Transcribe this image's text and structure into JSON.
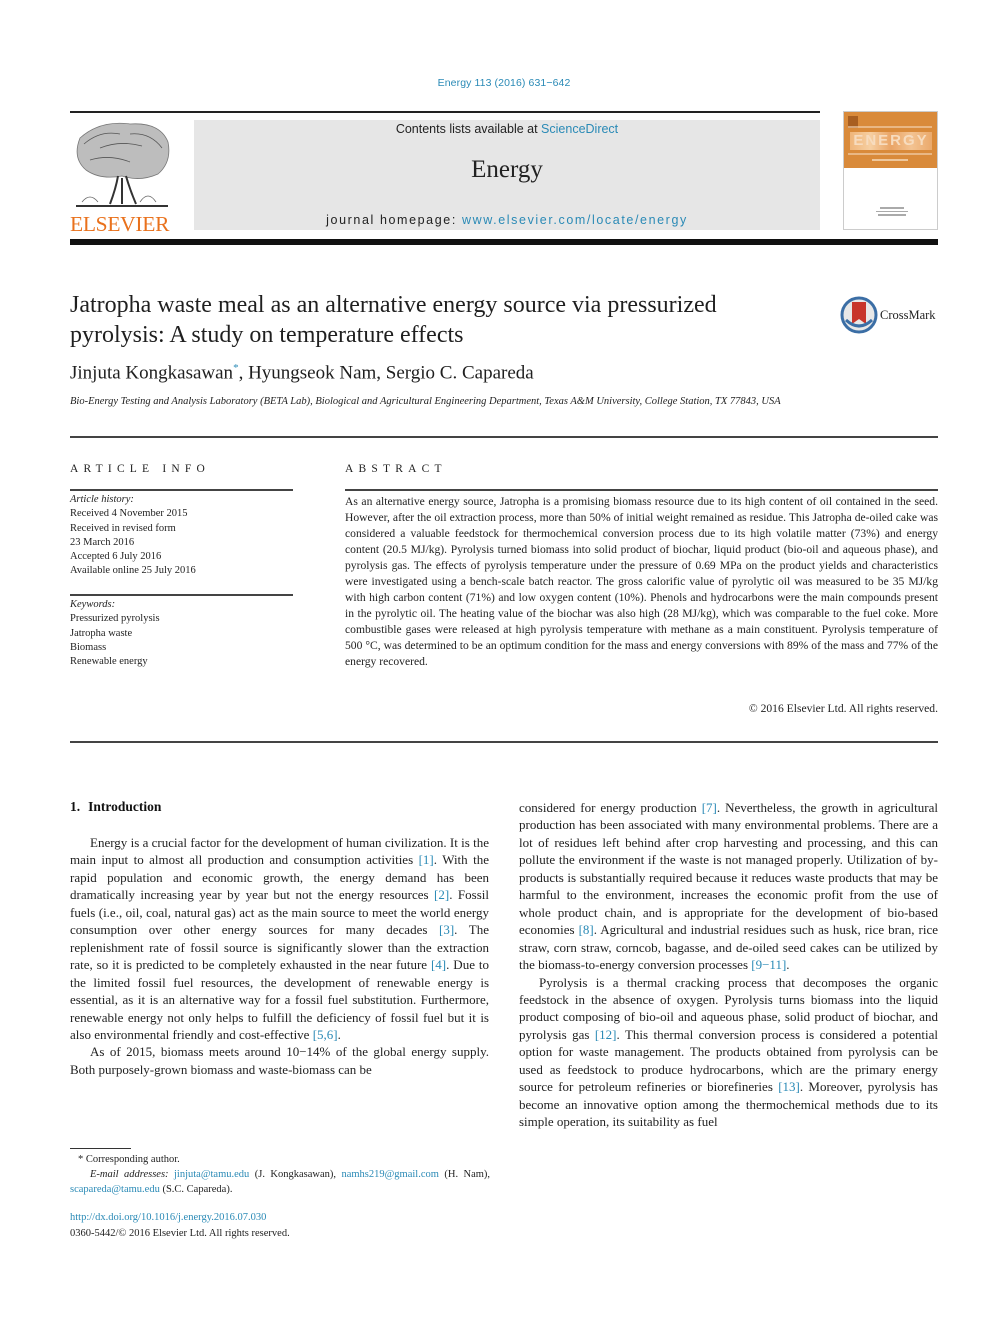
{
  "header": {
    "citation": "Energy 113 (2016) 631−642",
    "contents_prefix": "Contents lists available at ",
    "contents_link": "ScienceDirect",
    "journal_name": "Energy",
    "homepage_prefix": "journal homepage: ",
    "homepage_link": "www.elsevier.com/locate/energy",
    "publisher_logo": "ELSEVIER",
    "cover_word": "ENERGY",
    "crossmark_label": "CrossMark",
    "colors": {
      "link": "#2a8ab6",
      "elsevier_orange": "#e9711c",
      "cover_orange": "#d98a3a",
      "banner_gray": "#e6e6e6"
    }
  },
  "article": {
    "title_line1": "Jatropha waste meal as an alternative energy source via pressurized",
    "title_line2": "pyrolysis: A study on temperature effects",
    "authors": [
      {
        "name": "Jinjuta Kongkasawan",
        "mark": "*"
      },
      {
        "name": "Hyungseok Nam"
      },
      {
        "name": "Sergio C. Capareda"
      }
    ],
    "author_sep": ", ",
    "affiliation": "Bio-Energy Testing and Analysis Laboratory (BETA Lab), Biological and Agricultural Engineering Department, Texas A&M University, College Station, TX 77843, USA"
  },
  "article_info": {
    "heading": "ARTICLE INFO",
    "history_label": "Article history:",
    "history": [
      "Received 4 November 2015",
      "Received in revised form",
      "23 March 2016",
      "Accepted 6 July 2016",
      "Available online 25 July 2016"
    ],
    "keywords_label": "Keywords:",
    "keywords": [
      "Pressurized pyrolysis",
      "Jatropha waste",
      "Biomass",
      "Renewable energy"
    ]
  },
  "abstract": {
    "heading": "ABSTRACT",
    "text": "As an alternative energy source, Jatropha is a promising biomass resource due to its high content of oil contained in the seed. However, after the oil extraction process, more than 50% of initial weight remained as residue. This Jatropha de-oiled cake was considered a valuable feedstock for thermochemical conversion process due to its high volatile matter (73%) and energy content (20.5 MJ/kg). Pyrolysis turned biomass into solid product of biochar, liquid product (bio-oil and aqueous phase), and pyrolysis gas. The effects of pyrolysis temperature under the pressure of 0.69 MPa on the product yields and characteristics were investigated using a bench-scale batch reactor. The gross calorific value of pyrolytic oil was measured to be 35 MJ/kg with high carbon content (71%) and low oxygen content (10%). Phenols and hydrocarbons were the main compounds present in the pyrolytic oil. The heating value of the biochar was also high (28 MJ/kg), which was comparable to the fuel coke. More combustible gases were released at high pyrolysis temperature with methane as a main constituent. Pyrolysis temperature of 500 °C, was determined to be an optimum condition for the mass and energy conversions with 89% of the mass and 77% of the energy recovered.",
    "copyright": "© 2016 Elsevier Ltd. All rights reserved."
  },
  "body": {
    "section_number": "1.",
    "section_title": "Introduction",
    "left_p1": [
      {
        "t": "Energy is a crucial factor for the development of human civilization. It is the main input to almost all production and consumption activities "
      },
      {
        "ref": "[1]"
      },
      {
        "t": ". With the rapid population and economic growth, the energy demand has been dramatically increasing year by year but not the energy resources "
      },
      {
        "ref": "[2]"
      },
      {
        "t": ". Fossil fuels (i.e., oil, coal, natural gas) act as the main source to meet the world energy consumption over other energy sources for many decades "
      },
      {
        "ref": "[3]"
      },
      {
        "t": ". The replenishment rate of fossil source is significantly slower than the extraction rate, so it is predicted to be completely exhausted in the near future "
      },
      {
        "ref": "[4]"
      },
      {
        "t": ". Due to the limited fossil fuel resources, the development of renewable energy is essential, as it is an alternative way for a fossil fuel substitution. Furthermore, renewable energy not only helps to fulfill the deficiency of fossil fuel but it is also environmental friendly and cost-effective "
      },
      {
        "ref": "[5,6]"
      },
      {
        "t": "."
      }
    ],
    "left_p2": [
      {
        "t": "As of 2015, biomass meets around 10−14% of the global energy supply. Both purposely-grown biomass and waste-biomass can be"
      }
    ],
    "right_p1": [
      {
        "t": "considered for energy production "
      },
      {
        "ref": "[7]"
      },
      {
        "t": ". Nevertheless, the growth in agricultural production has been associated with many environmental problems. There are a lot of residues left behind after crop harvesting and processing, and this can pollute the environment if the waste is not managed properly. Utilization of by-products is substantially required because it reduces waste products that may be harmful to the environment, increases the economic profit from the use of whole product chain, and is appropriate for the development of bio-based economies "
      },
      {
        "ref": "[8]"
      },
      {
        "t": ". Agricultural and industrial residues such as husk, rice bran, rice straw, corn straw, corncob, bagasse, and de-oiled seed cakes can be utilized by the biomass-to-energy conversion processes "
      },
      {
        "ref": "[9−11]"
      },
      {
        "t": "."
      }
    ],
    "right_p2": [
      {
        "t": "Pyrolysis is a thermal cracking process that decomposes the organic feedstock in the absence of oxygen. Pyrolysis turns biomass into the liquid product composing of bio-oil and aqueous phase, solid product of biochar, and pyrolysis gas "
      },
      {
        "ref": "[12]"
      },
      {
        "t": ". This thermal conversion process is considered a potential option for waste management. The products obtained from pyrolysis can be used as feedstock to produce hydrocarbons, which are the primary energy source for petroleum refineries or biorefineries "
      },
      {
        "ref": "[13]"
      },
      {
        "t": ". Moreover, pyrolysis has become an innovative option among the thermochemical methods due to its simple operation, its suitability as fuel"
      }
    ]
  },
  "footnotes": {
    "corresponding_mark": "*",
    "corresponding_text": "Corresponding author.",
    "email_label": "E-mail addresses:",
    "emails": [
      {
        "address": "jinjuta@tamu.edu",
        "owner": "(J. Kongkasawan),"
      },
      {
        "address": "namhs219@gmail.com",
        "owner": "(H. Nam),"
      },
      {
        "address": "scapareda@tamu.edu",
        "owner": "(S.C. Capareda)."
      }
    ],
    "doi": "http://dx.doi.org/10.1016/j.energy.2016.07.030",
    "issn_copyright": "0360-5442/© 2016 Elsevier Ltd. All rights reserved."
  }
}
